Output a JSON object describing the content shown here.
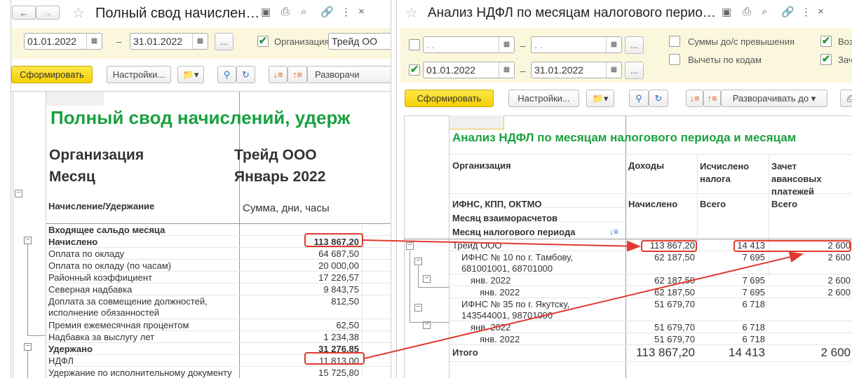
{
  "left": {
    "title": "Полный свод начислен…",
    "date_from": "01.01.2022",
    "date_to": "31.01.2022",
    "dash": "–",
    "more": "...",
    "org_label": "Организация:",
    "org_value": "Трейд ОО",
    "generate": "Сформировать",
    "settings": "Настройки...",
    "expand": "Разворачи",
    "report_title": "Полный свод начислений, удерж",
    "org_h": "Организация",
    "org_v": "Трейд ООО",
    "month_h": "Месяц",
    "month_v": "Январь 2022",
    "col1": "Начисление/Удержание",
    "col2": "Сумма, дни, часы",
    "rows": [
      {
        "label": "Входящее сальдо месяца",
        "value": "",
        "bold": true
      },
      {
        "label": "Начислено",
        "value": "113 867,20",
        "bold": true
      },
      {
        "label": "Оплата по окладу",
        "value": "64 687,50"
      },
      {
        "label": "Оплата по окладу (по часам)",
        "value": "20 000,00"
      },
      {
        "label": "Районный коэффициент",
        "value": "17 226,57"
      },
      {
        "label": "Северная надбавка",
        "value": "9 843,75"
      },
      {
        "label": "Доплата за совмещение должностей,",
        "label2": "исполнение обязанностей",
        "value": "812,50"
      },
      {
        "label": "Премия ежемесячная процентом",
        "value": "62,50"
      },
      {
        "label": "Надбавка за выслугу лет",
        "value": "1 234,38"
      },
      {
        "label": "Удержано",
        "value": "31 276,85",
        "bold": true
      },
      {
        "label": "НДФЛ",
        "value": "11 813,00"
      },
      {
        "label": "Удержание по исполнительному документу",
        "value": "15 725,80"
      }
    ]
  },
  "right": {
    "title": "Анализ НДФЛ по месяцам налогового перио…",
    "empty_date": " .  . ",
    "date_from": "01.01.2022",
    "date_to": "31.01.2022",
    "dash": "–",
    "more": "...",
    "cb1": "Суммы до/с превышения",
    "cb2": "Вычеты по кодам",
    "cb3": "Воз",
    "cb4": "Зач",
    "generate": "Сформировать",
    "settings": "Настройки...",
    "expand": "Разворачивать до",
    "report_title": "Анализ НДФЛ по месяцам налогового периода и месяцам",
    "h_org": "Организация",
    "h_inc": "Доходы",
    "h_calc": "Исчислено налога",
    "h_off1": "Зачет",
    "h_off2": "авансовых",
    "h_off3": "платежей",
    "h_ifns": "ИФНС, КПП, ОКТМО",
    "h_accr": "Начислено",
    "h_all1": "Всего",
    "h_all2": "Всего",
    "h_m1": "Месяц взаиморасчетов",
    "h_m2": "Месяц налогового периода",
    "rows": [
      {
        "label": "Трейд ООО",
        "inc": "113 867,20",
        "calc": "14 413",
        "off": "2 600"
      },
      {
        "label": "ИФНС № 10 по г. Тамбову,",
        "label2": "681001001, 68701000",
        "inc": "62 187,50",
        "calc": "7 695",
        "off": "2 600"
      },
      {
        "label": "янв. 2022",
        "inc": "62 187,50",
        "calc": "7 695",
        "off": "2 600"
      },
      {
        "label": "янв. 2022",
        "inc": "62 187,50",
        "calc": "7 695",
        "off": "2 600"
      },
      {
        "label": "ИФНС № 35 по г. Якутску,",
        "label2": "143544001, 98701000",
        "inc": "51 679,70",
        "calc": "6 718",
        "off": ""
      },
      {
        "label": "янв. 2022",
        "inc": "51 679,70",
        "calc": "6 718",
        "off": ""
      },
      {
        "label": "янв. 2022",
        "inc": "51 679,70",
        "calc": "6 718",
        "off": ""
      }
    ],
    "total_label": "Итого",
    "total_inc": "113 867,20",
    "total_calc": "14 413",
    "total_off": "2 600"
  }
}
